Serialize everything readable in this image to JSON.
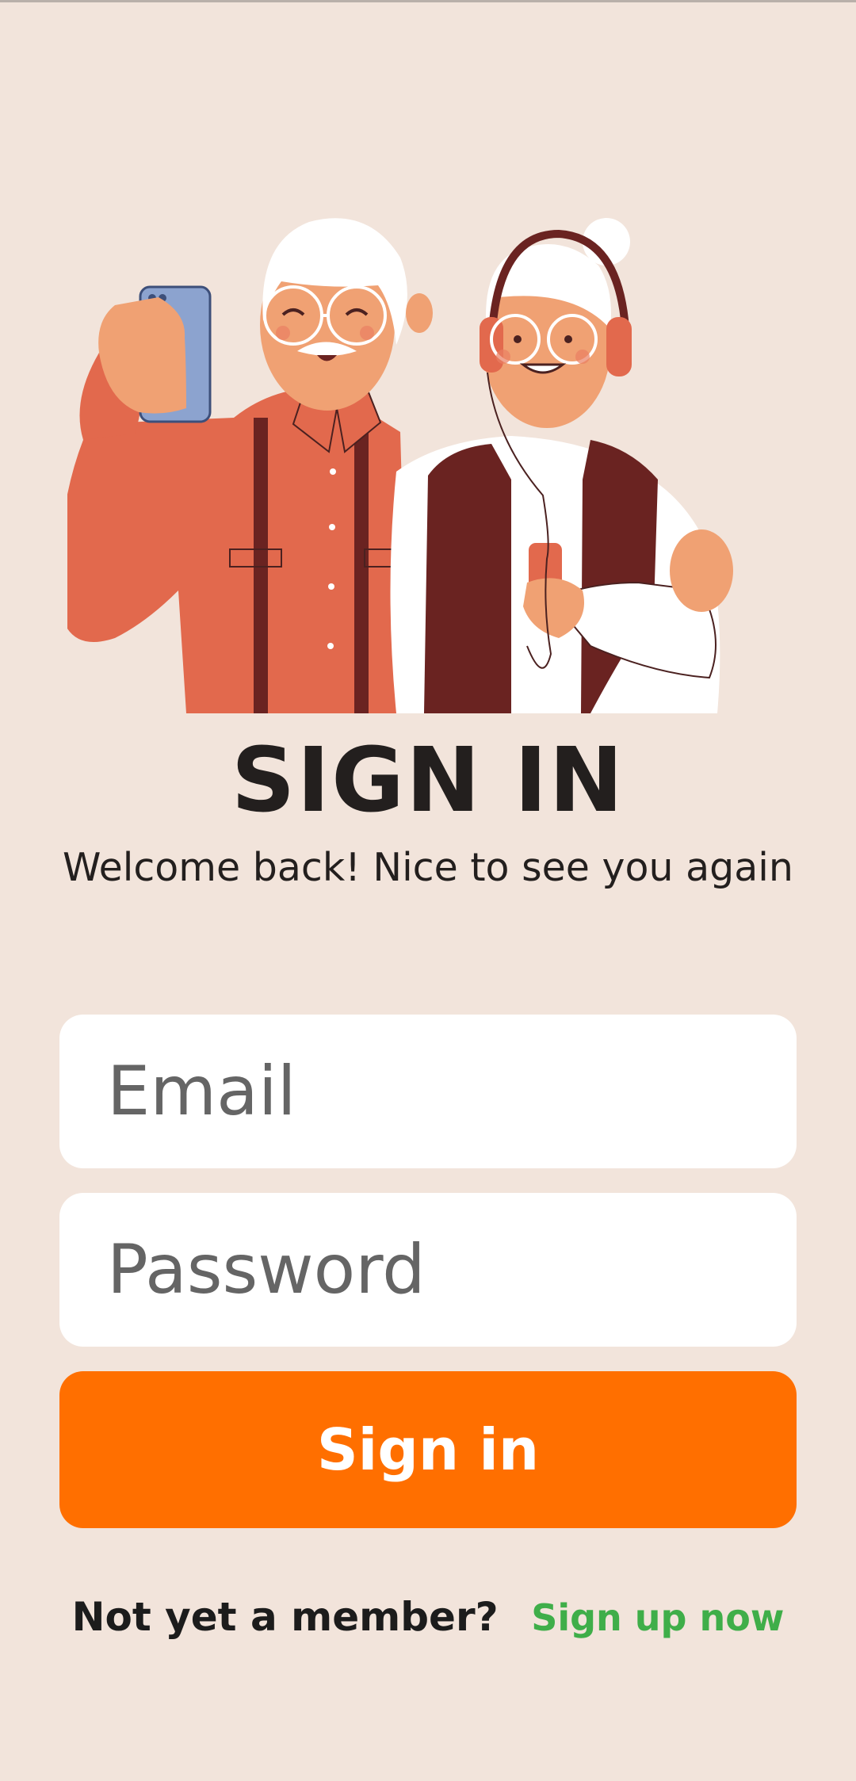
{
  "header": {
    "title": "SIGN IN",
    "subtitle": "Welcome back! Nice to see you again"
  },
  "illustration": {
    "icon": "senior-couple-illustration"
  },
  "form": {
    "email_placeholder": "Email",
    "password_placeholder": "Password",
    "submit_label": "Sign in"
  },
  "footer": {
    "prompt": "Not yet a member?",
    "signup_link": "Sign up now"
  },
  "colors": {
    "background": "#f2e4db",
    "accent": "#ff6f00",
    "link": "#3fae49",
    "text": "#231f1e",
    "field_background": "#ffffff"
  }
}
